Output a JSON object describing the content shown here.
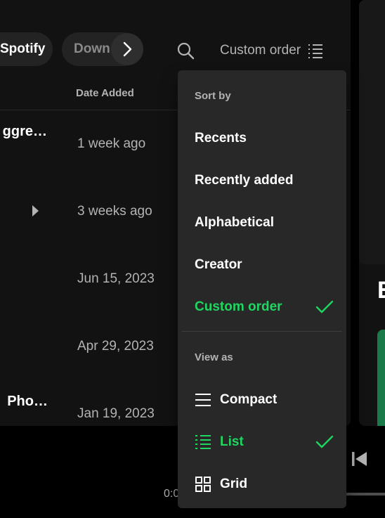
{
  "filters": {
    "chip_spotify": "Spotify",
    "chip_downloaded": "Down"
  },
  "toolbar": {
    "sort_label": "Custom order",
    "search_icon": "search-icon",
    "sort_icon": "list-icon"
  },
  "table": {
    "header_date_added": "Date Added",
    "rows": [
      {
        "title": "ggre…",
        "date": "1 week ago"
      },
      {
        "title": "",
        "date": "3 weeks ago"
      },
      {
        "title": "",
        "date": "Jun 15, 2023"
      },
      {
        "title": "",
        "date": "Apr 29, 2023"
      },
      {
        "title": "Pho…",
        "date": "Jan 19, 2023"
      }
    ]
  },
  "sort_menu": {
    "sort_by_label": "Sort by",
    "sort_options": [
      "Recents",
      "Recently added",
      "Alphabetical",
      "Creator",
      "Custom order"
    ],
    "selected_sort": "Custom order",
    "view_as_label": "View as",
    "view_options": [
      "Compact",
      "List",
      "Grid"
    ],
    "selected_view": "List"
  },
  "player": {
    "time_elapsed": "0:0"
  },
  "right_panel": {
    "heading_initial": "E"
  },
  "colors": {
    "accent": "#1ed760",
    "background": "#121212",
    "menu_bg": "#282828",
    "muted_text": "#b3b3b3"
  }
}
